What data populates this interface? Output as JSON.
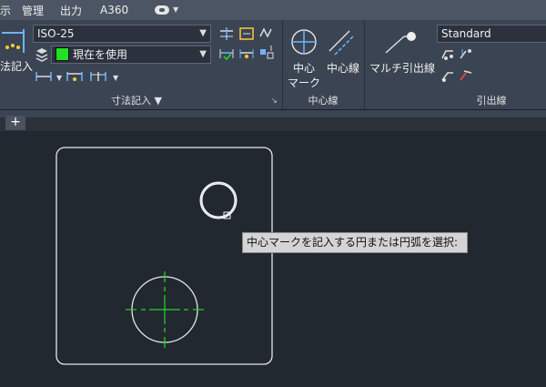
{
  "menubar": {
    "items": [
      "示",
      "管理",
      "出力",
      "A360"
    ]
  },
  "ribbon": {
    "dim_style": "ISO-25",
    "dim_layer": "現在を使用",
    "big_button_label": "法記入",
    "dim_panel_title": "寸法記入",
    "centermark_label_1": "中心",
    "centermark_label_2": "マーク",
    "centerline_label": "中心線",
    "centerline_panel_title": "中心線",
    "multileader_label": "マルチ引出線",
    "leader_style": "Standard",
    "leader_panel_title": "引出線"
  },
  "prompt": {
    "tooltip": "中心マークを記入する円または円弧を選択:"
  },
  "colors": {
    "canvas": "#212830",
    "ribbon": "#3b4453",
    "center_mark": "#22dd22"
  }
}
